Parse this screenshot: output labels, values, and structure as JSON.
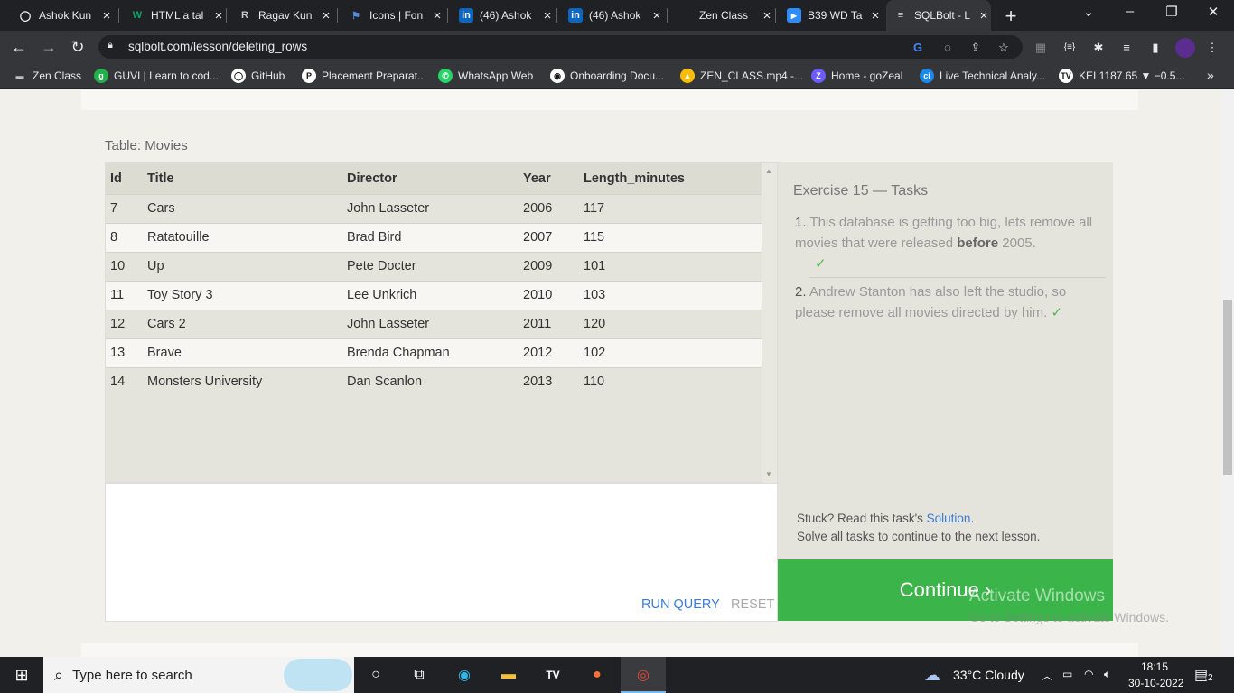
{
  "browser": {
    "tabs": [
      {
        "title": "Ashok Kun",
        "icon": "github-icon",
        "color": "#ffffff"
      },
      {
        "title": "HTML a tal",
        "icon": "w3-icon",
        "color": "#04aa6d"
      },
      {
        "title": "Ragav Kun",
        "icon": "r-script-icon",
        "color": "#c9c9c9"
      },
      {
        "title": "Icons | Fon",
        "icon": "flag-icon",
        "color": "#528dd7"
      },
      {
        "title": "(46) Ashok",
        "icon": "linkedin-icon",
        "color": "#0a66c2"
      },
      {
        "title": "(46) Ashok",
        "icon": "linkedin-icon",
        "color": "#0a66c2"
      },
      {
        "title": "Zen Class",
        "icon": "zen-icon",
        "color": "#2d2d2d"
      },
      {
        "title": "B39 WD Ta",
        "icon": "zoom-icon",
        "color": "#2d8cff"
      },
      {
        "title": "SQLBolt - L",
        "icon": "database-icon",
        "color": "#cccccc"
      }
    ],
    "new_tab_label": "+",
    "url": "sqlbolt.com/lesson/deleting_rows",
    "bookmarks": [
      {
        "label": "Zen Class",
        "icon": "folder-icon",
        "color": "#444"
      },
      {
        "label": "GUVI | Learn to cod...",
        "icon": "guvi-icon",
        "color": "#22b04b"
      },
      {
        "label": "GitHub",
        "icon": "github-icon",
        "color": "#333"
      },
      {
        "label": "Placement Preparat...",
        "icon": "p-icon",
        "color": "#fff"
      },
      {
        "label": "WhatsApp Web",
        "icon": "whatsapp-icon",
        "color": "#25d366"
      },
      {
        "label": "Onboarding Docu...",
        "icon": "globe-icon",
        "color": "#fff"
      },
      {
        "label": "ZEN_CLASS.mp4 -...",
        "icon": "drive-icon",
        "color": "#fbbc04"
      },
      {
        "label": "Home - goZeal",
        "icon": "gozeal-icon",
        "color": "#6b5cff"
      },
      {
        "label": "Live Technical Analy...",
        "icon": "ci-icon",
        "color": "#1e88e5"
      },
      {
        "label": "KEI 1187.65 ▼ −0.5...",
        "icon": "tradingview-icon",
        "color": "#fff"
      }
    ],
    "more_bookmarks": "»"
  },
  "page": {
    "table_caption": "Table: Movies",
    "columns": [
      "Id",
      "Title",
      "Director",
      "Year",
      "Length_minutes"
    ],
    "rows": [
      [
        "7",
        "Cars",
        "John Lasseter",
        "2006",
        "117"
      ],
      [
        "8",
        "Ratatouille",
        "Brad Bird",
        "2007",
        "115"
      ],
      [
        "10",
        "Up",
        "Pete Docter",
        "2009",
        "101"
      ],
      [
        "11",
        "Toy Story 3",
        "Lee Unkrich",
        "2010",
        "103"
      ],
      [
        "12",
        "Cars 2",
        "John Lasseter",
        "2011",
        "120"
      ],
      [
        "13",
        "Brave",
        "Brenda Chapman",
        "2012",
        "102"
      ],
      [
        "14",
        "Monsters University",
        "Dan Scanlon",
        "2013",
        "110"
      ]
    ],
    "run_query": "RUN QUERY",
    "reset": "RESET",
    "exercise_title": "Exercise 15 — Tasks",
    "tasks": [
      {
        "num": "1.",
        "text_a": "This database is getting too big, lets remove all movies that were released ",
        "bold": "before",
        "text_b": " 2005.",
        "check": "✓"
      },
      {
        "num": "2.",
        "text_a": "Andrew Stanton has also left the studio, so please remove all movies directed by him.",
        "check": "✓"
      }
    ],
    "stuck_text": "Stuck? Read this task's ",
    "solution_link": "Solution",
    "stuck_end": ".",
    "solve_all": "Solve all tasks to continue to the next lesson.",
    "continue": "Continue ›",
    "activate_title": "Activate Windows",
    "activate_sub": "Go to Settings to activate Windows."
  },
  "taskbar": {
    "search_placeholder": "Type here to search",
    "weather": "33°C  Cloudy",
    "time": "18:15",
    "date": "30-10-2022",
    "notification_count": "2"
  }
}
